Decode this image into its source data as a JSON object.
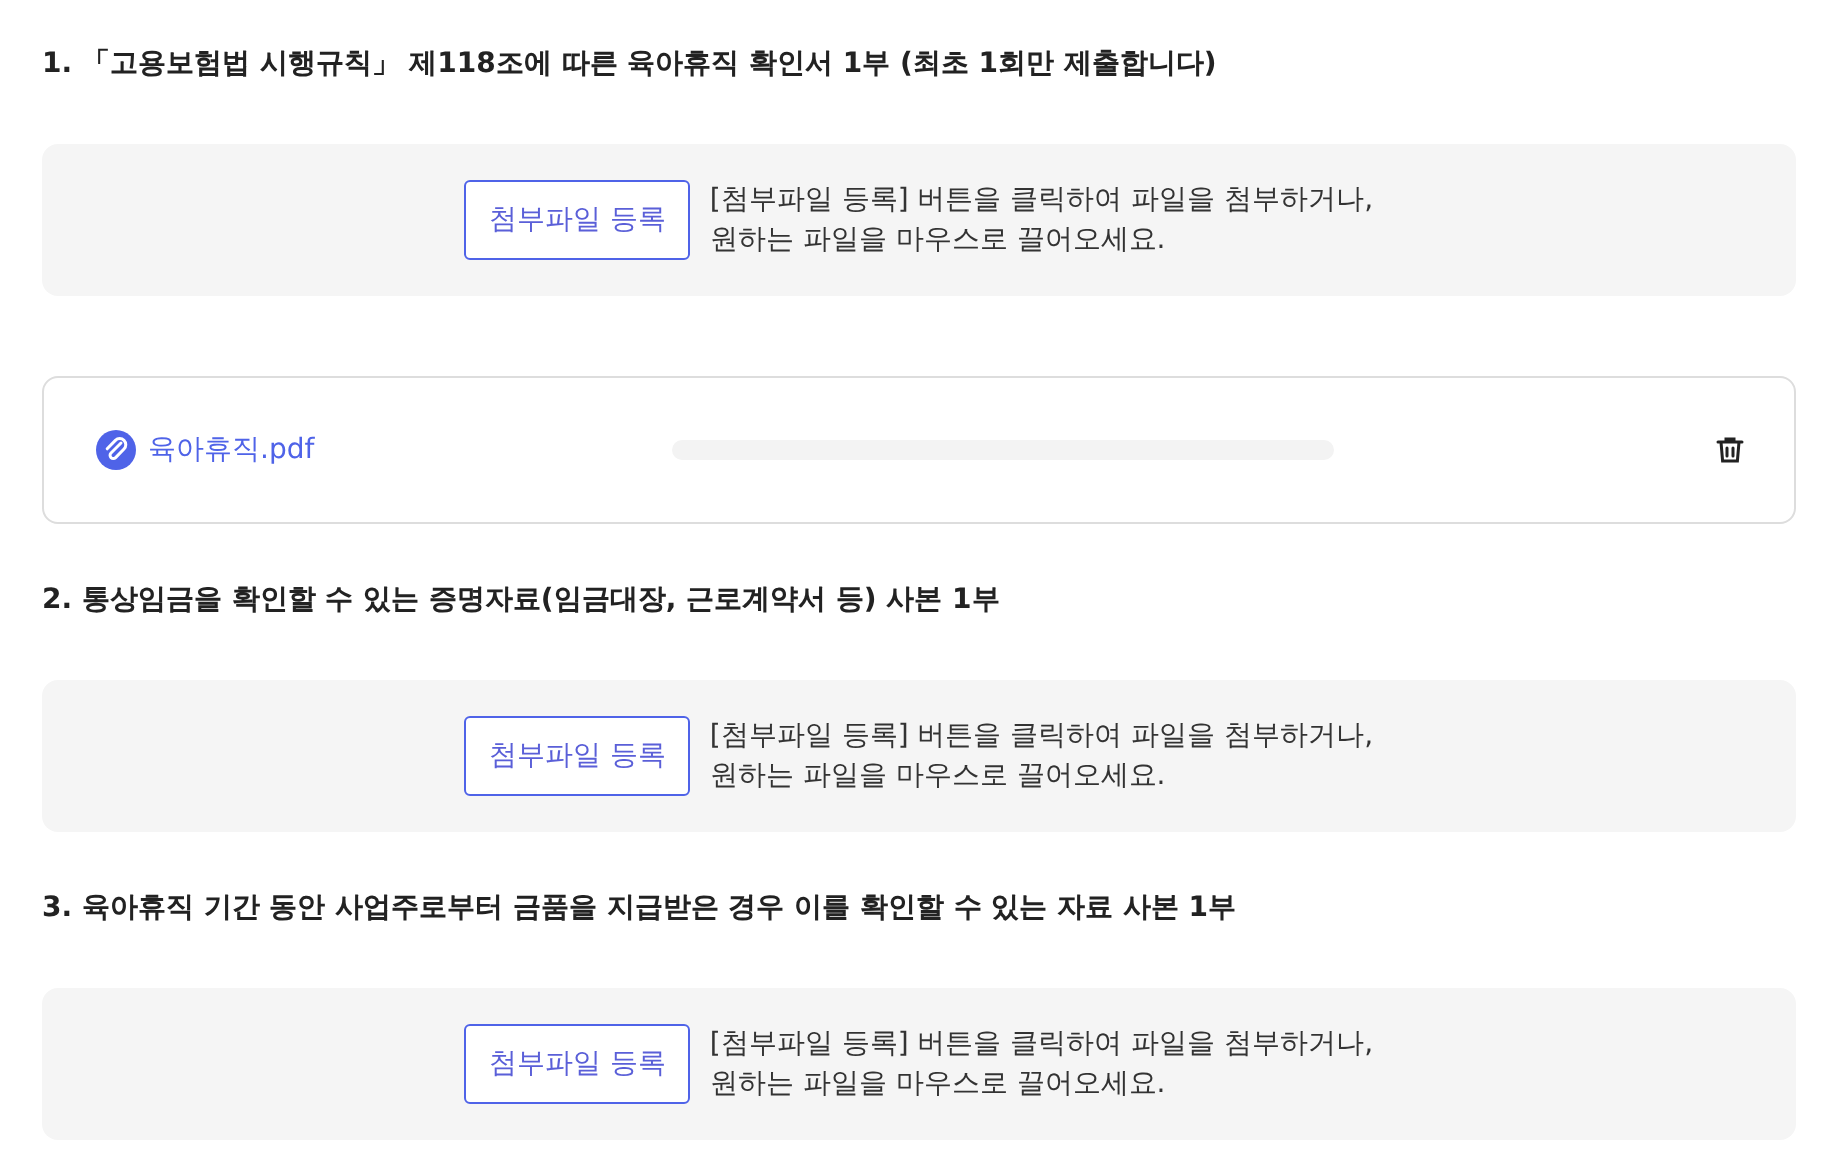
{
  "sections": [
    {
      "title": "1. 「고용보험법 시행규칙」 제118조에 따른 육아휴직 확인서 1부 (최초 1회만 제출합니다)",
      "upload": {
        "button": "첨부파일 등록",
        "hint_line1": "[첨부파일 등록] 버튼을 클릭하여 파일을 첨부하거나,",
        "hint_line2": "원하는 파일을 마우스로 끌어오세요."
      },
      "files": [
        {
          "name": "육아휴직.pdf"
        }
      ]
    },
    {
      "title": "2. 통상임금을 확인할 수 있는 증명자료(임금대장, 근로계약서 등) 사본 1부",
      "upload": {
        "button": "첨부파일 등록",
        "hint_line1": "[첨부파일 등록] 버튼을 클릭하여 파일을 첨부하거나,",
        "hint_line2": "원하는 파일을 마우스로 끌어오세요."
      }
    },
    {
      "title": "3. 육아휴직 기간 동안 사업주로부터 금품을 지급받은 경우 이를 확인할 수 있는 자료 사본 1부",
      "upload": {
        "button": "첨부파일 등록",
        "hint_line1": "[첨부파일 등록] 버튼을 클릭하여 파일을 첨부하거나,",
        "hint_line2": "원하는 파일을 마우스로 끌어오세요."
      }
    }
  ]
}
